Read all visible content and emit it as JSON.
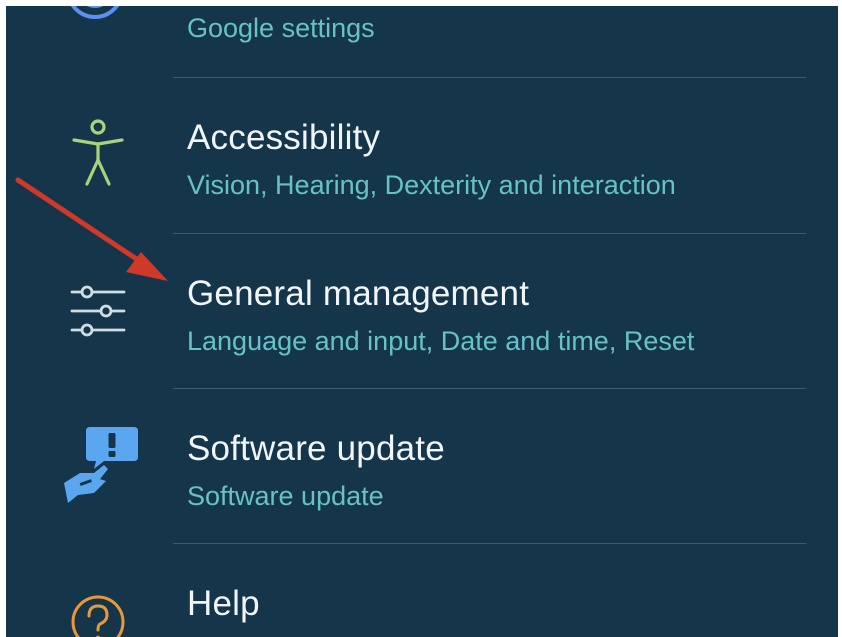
{
  "settings": {
    "items": [
      {
        "id": "google",
        "title": "",
        "subtitle": "Google settings",
        "icon": "google-icon"
      },
      {
        "id": "accessibility",
        "title": "Accessibility",
        "subtitle": "Vision, Hearing, Dexterity and interaction",
        "icon": "accessibility-icon"
      },
      {
        "id": "general",
        "title": "General management",
        "subtitle": "Language and input, Date and time, Reset",
        "icon": "sliders-icon"
      },
      {
        "id": "software",
        "title": "Software update",
        "subtitle": "Software update",
        "icon": "software-update-icon"
      },
      {
        "id": "help",
        "title": "Help",
        "subtitle": "",
        "icon": "help-icon"
      }
    ]
  },
  "colors": {
    "background": "#15364a",
    "title": "#f1f5f7",
    "subtitle": "#66c2c7",
    "divider": "#3d5b6d",
    "annotation_arrow": "#d0392a"
  }
}
